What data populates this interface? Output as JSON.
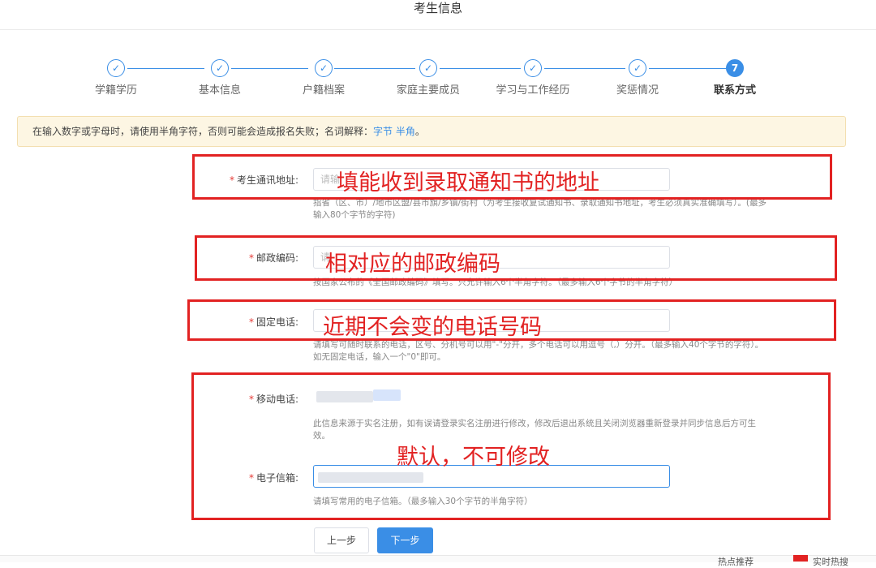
{
  "page": {
    "title": "考生信息"
  },
  "steps": [
    {
      "label": "学籍学历",
      "state": "done",
      "icon": "check-icon"
    },
    {
      "label": "基本信息",
      "state": "done",
      "icon": "check-icon"
    },
    {
      "label": "户籍档案",
      "state": "done",
      "icon": "check-icon"
    },
    {
      "label": "家庭主要成员",
      "state": "done",
      "icon": "check-icon"
    },
    {
      "label": "学习与工作经历",
      "state": "done",
      "icon": "check-icon"
    },
    {
      "label": "奖惩情况",
      "state": "done",
      "icon": "check-icon"
    },
    {
      "label": "联系方式",
      "state": "active",
      "number": "7"
    }
  ],
  "alert": {
    "text": "在输入数字或字母时，请使用半角字符，否则可能会造成报名失败；名词解释：",
    "link1": "字节",
    "link2": "半角",
    "end": "。"
  },
  "form": {
    "address": {
      "label": "考生通讯地址:",
      "placeholder": "请输",
      "help": "指省（区、市）/地市区盟/县市旗/乡镇/街村（为考生接收复试通知书、录取通知书地址，考生必须真实准确填写）。(最多输入80个字节的字符)"
    },
    "postcode": {
      "label": "邮政编码:",
      "placeholder": "请",
      "help": "按国家公布的《全国邮政编码》填写。只允许输入6个半角字符。（最多输入6个字节的半角字符）"
    },
    "phone": {
      "label": "固定电话:",
      "placeholder": "",
      "help": "请填写可随时联系的电话，区号、分机号可以用\"-\"分开，多个电话可以用逗号（,）分开。（最多输入40个字节的字符）。如无固定电话，输入一个\"0\"即可。"
    },
    "mobile": {
      "label": "移动电话:",
      "help": "此信息来源于实名注册，如有误请登录实名注册进行修改，修改后退出系统且关闭浏览器重新登录并同步信息后方可生效。"
    },
    "email": {
      "label": "电子信箱:",
      "help": "请填写常用的电子信箱。（最多输入30个字节的半角字符）"
    },
    "required_mark": "*"
  },
  "annotations": {
    "address": "填能收到录取通知书的地址",
    "postcode": "相对应的邮政编码",
    "phone": "近期不会变的电话号码",
    "default": "默认，不可修改"
  },
  "buttons": {
    "prev": "上一步",
    "next": "下一步"
  },
  "footer": {
    "item1": "热点推荐",
    "item2": "实时热搜"
  },
  "colors": {
    "accent": "#3a8ee6",
    "annotation": "#e22222",
    "required": "#e53935",
    "alert_bg": "#fdf6e3"
  }
}
